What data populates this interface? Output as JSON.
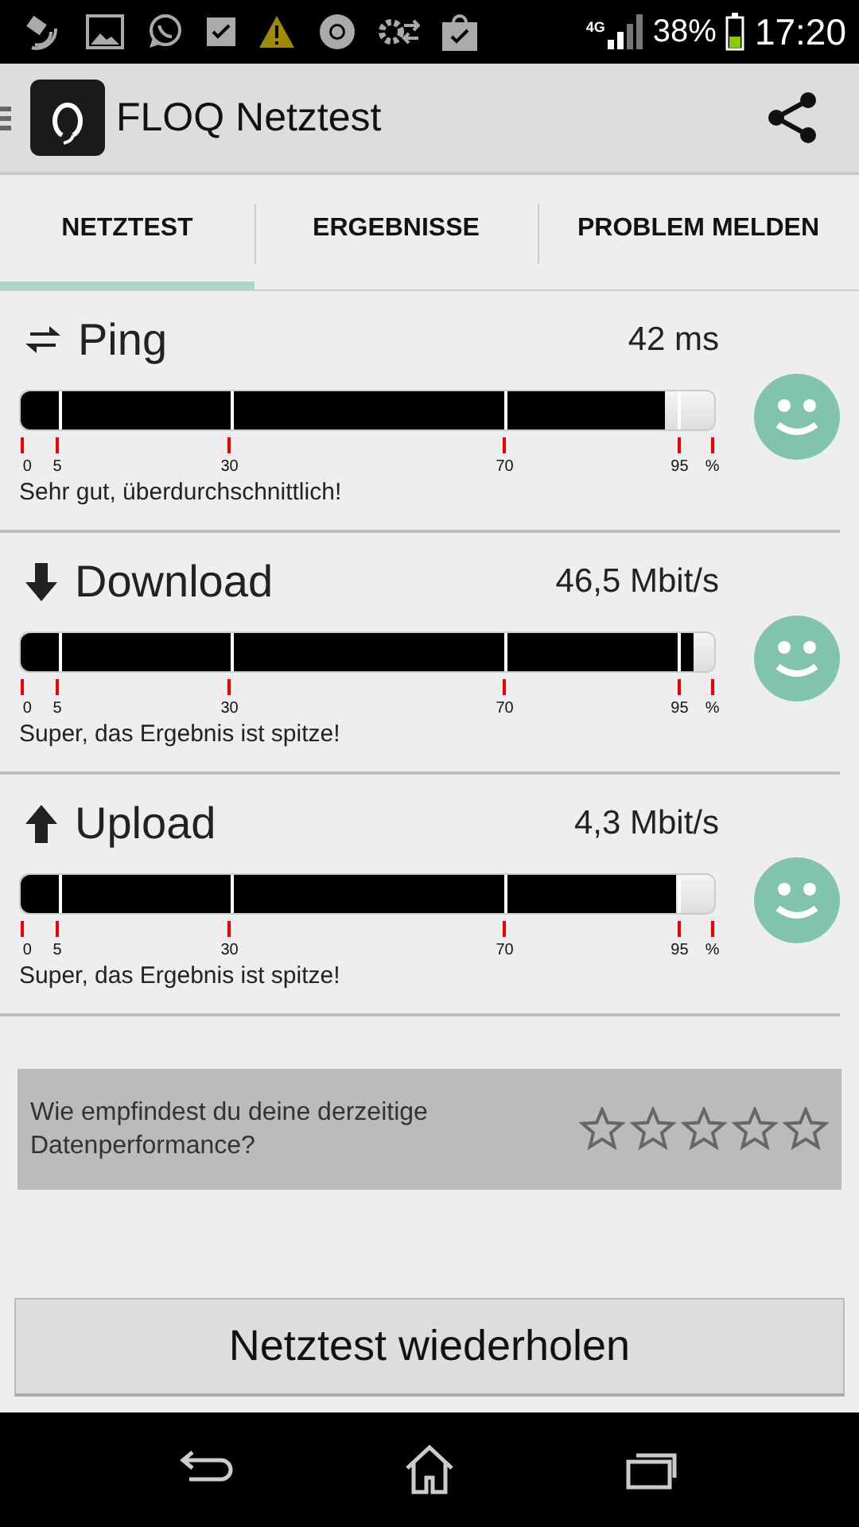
{
  "status_bar": {
    "network": "4G",
    "battery": "38%",
    "time": "17:20"
  },
  "app_bar": {
    "title": "FLOQ Netztest"
  },
  "tabs": [
    {
      "label": "NETZTEST",
      "selected": true
    },
    {
      "label": "ERGEBNISSE",
      "selected": false
    },
    {
      "label": "PROBLEM MELDEN",
      "selected": false
    }
  ],
  "metrics": [
    {
      "kind": "ping",
      "name": "Ping",
      "reading": "42 ms",
      "level": 0.93,
      "scale_labels": [
        "0",
        "5",
        "30",
        "70",
        "95",
        "%"
      ],
      "verdict": "Sehr gut, überdurchschnittlich!"
    },
    {
      "kind": "download",
      "name": "Download",
      "reading": "46,5 Mbit/s",
      "level": 0.97,
      "scale_labels": [
        "0",
        "5",
        "30",
        "70",
        "95",
        "%"
      ],
      "verdict": "Super, das Ergebnis ist spitze!"
    },
    {
      "kind": "upload",
      "name": "Upload",
      "reading": "4,3 Mbit/s",
      "level": 0.945,
      "scale_labels": [
        "0",
        "5",
        "30",
        "70",
        "95",
        "%"
      ],
      "verdict": "Super, das Ergebnis ist spitze!"
    }
  ],
  "rating": {
    "question": "Wie empfindest du deine derzeitige Datenperformance?",
    "stars": 0
  },
  "button": "Netztest wiederholen"
}
